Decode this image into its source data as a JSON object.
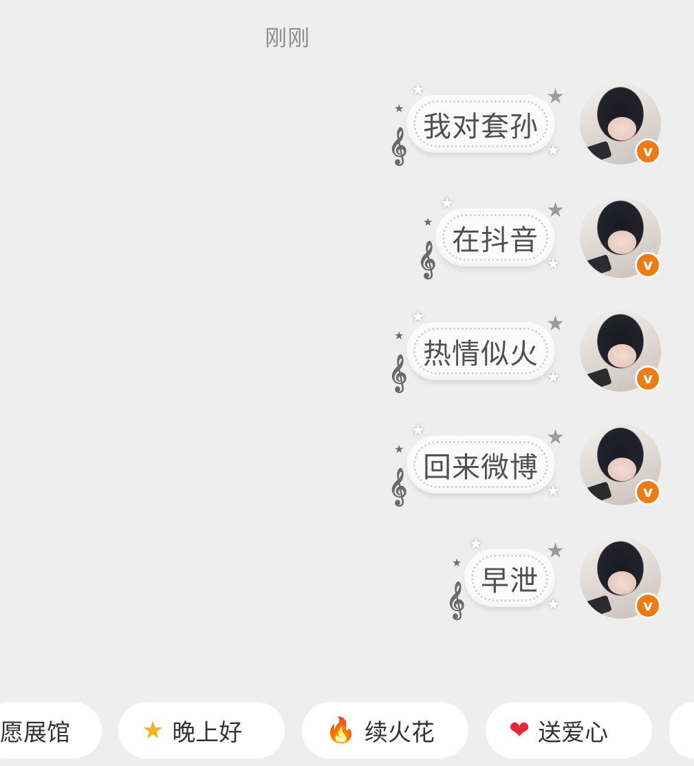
{
  "timestamp": "刚刚",
  "messages": [
    {
      "text": "我对套孙"
    },
    {
      "text": "在抖音"
    },
    {
      "text": "热情似火"
    },
    {
      "text": "回来微博"
    },
    {
      "text": "早泄"
    }
  ],
  "avatar_badge": "v",
  "quick_replies": [
    {
      "label": "愿展馆",
      "icon": ""
    },
    {
      "label": "晚上好",
      "icon": "star-face-icon"
    },
    {
      "label": "续火花",
      "icon": "fire-icon"
    },
    {
      "label": "送爱心",
      "icon": "heart-icon"
    }
  ],
  "colors": {
    "background": "#eeeeee",
    "badge": "#f07a12",
    "bubble": "#fbfbfb"
  }
}
